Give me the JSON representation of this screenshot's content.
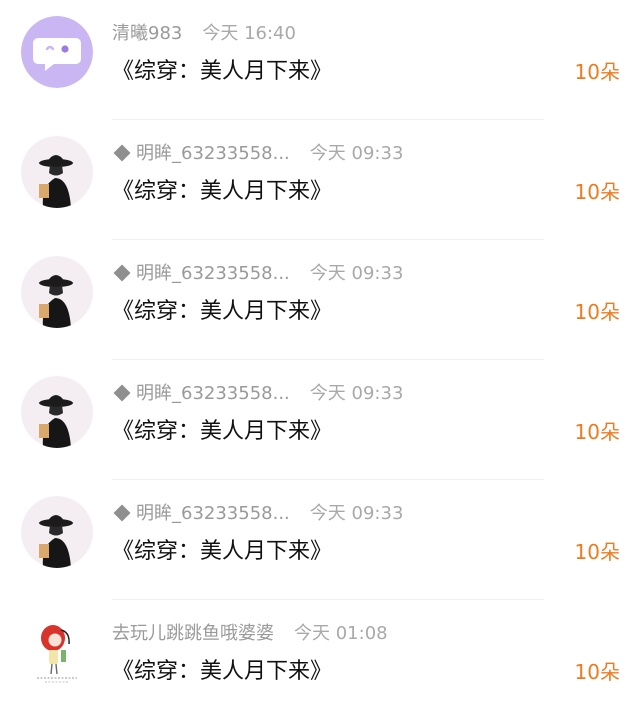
{
  "colors": {
    "count_text": "#f07a1e",
    "meta_text": "#9a9a9a",
    "title_text": "#111111"
  },
  "items": [
    {
      "avatar": "chat-bubble-face-icon",
      "verified": false,
      "name": "清曦983",
      "time": "今天 16:40",
      "title": "《综穿：美人月下来》",
      "count": "10朵"
    },
    {
      "avatar": "woman-in-hat-avatar",
      "verified": true,
      "name": "明眸_63233558...",
      "time": "今天 09:33",
      "title": "《综穿：美人月下来》",
      "count": "10朵"
    },
    {
      "avatar": "woman-in-hat-avatar",
      "verified": true,
      "name": "明眸_63233558...",
      "time": "今天 09:33",
      "title": "《综穿：美人月下来》",
      "count": "10朵"
    },
    {
      "avatar": "woman-in-hat-avatar",
      "verified": true,
      "name": "明眸_63233558...",
      "time": "今天 09:33",
      "title": "《综穿：美人月下来》",
      "count": "10朵"
    },
    {
      "avatar": "woman-in-hat-avatar",
      "verified": true,
      "name": "明眸_63233558...",
      "time": "今天 09:33",
      "title": "《综穿：美人月下来》",
      "count": "10朵"
    },
    {
      "avatar": "cartoon-girl-avatar",
      "verified": false,
      "name": "去玩儿跳跳鱼哦婆婆",
      "time": "今天 01:08",
      "title": "《综穿：美人月下来》",
      "count": "10朵"
    }
  ]
}
